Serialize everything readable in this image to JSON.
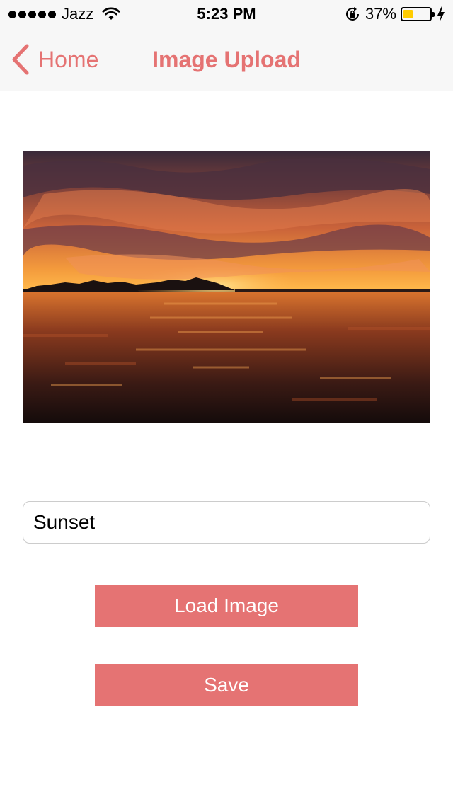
{
  "status_bar": {
    "carrier": "Jazz",
    "time": "5:23 PM",
    "battery_percent": "37%",
    "battery_level": 0.37,
    "battery_color": "#ffcc00",
    "icons": [
      "signal-dots-icon",
      "wifi-icon",
      "rotation-lock-icon",
      "battery-icon",
      "charging-bolt-icon"
    ]
  },
  "nav": {
    "back_label": "Home",
    "title": "Image Upload",
    "accent_color": "#e57373"
  },
  "form": {
    "name_value": "Sunset",
    "load_label": "Load Image",
    "save_label": "Save"
  }
}
